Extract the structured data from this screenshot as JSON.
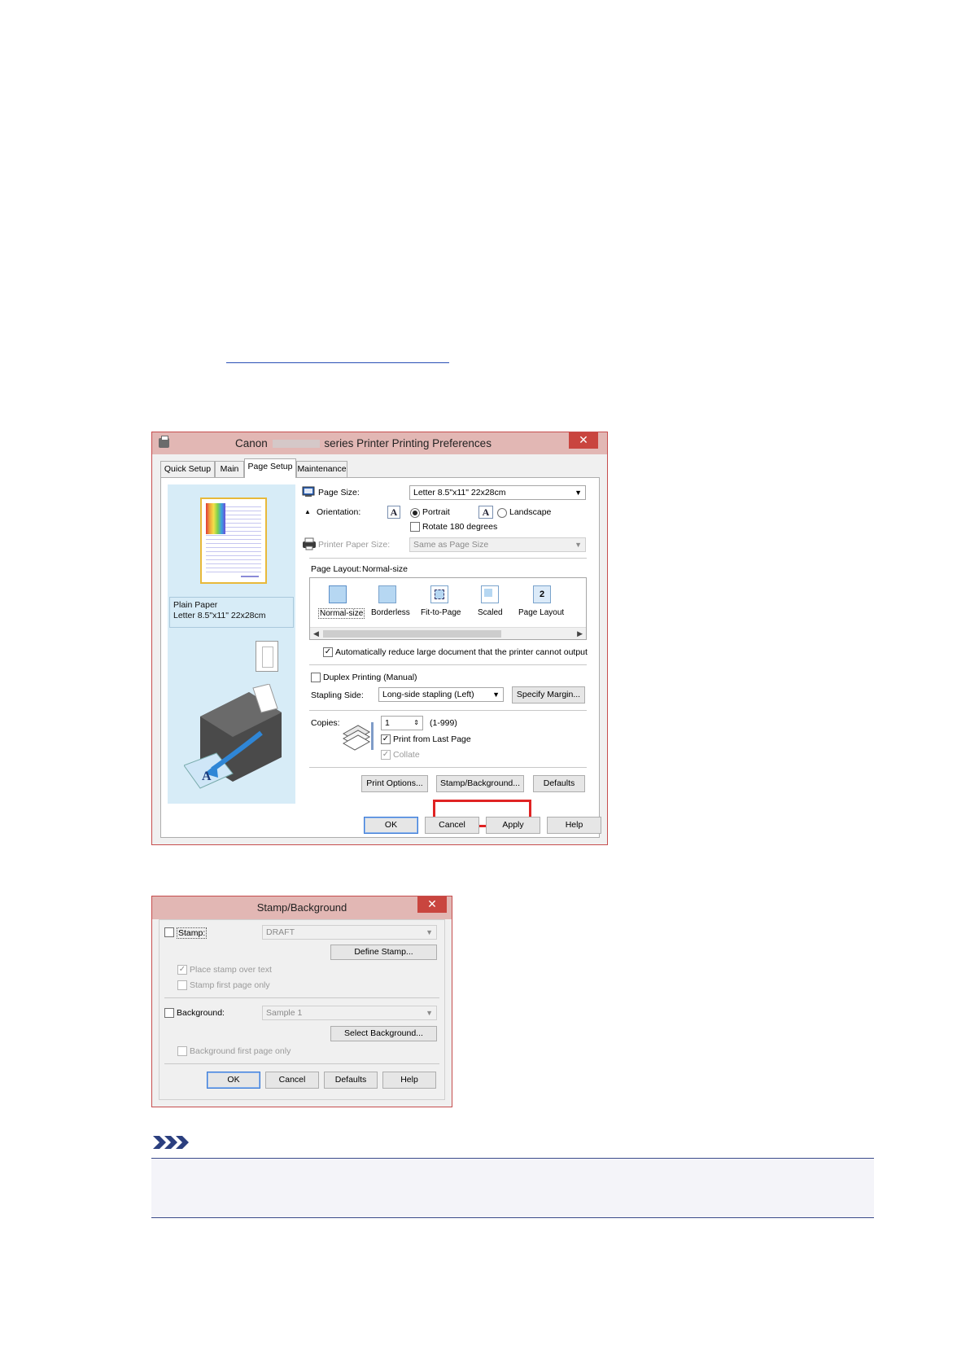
{
  "main_dialog": {
    "title_prefix": "Canon",
    "title_suffix": "series Printer Printing Preferences",
    "close_glyph": "✕",
    "tabs": [
      "Quick Setup",
      "Main",
      "Page Setup",
      "Maintenance"
    ],
    "media_type": "Plain Paper",
    "media_size": "Letter 8.5\"x11\" 22x28cm",
    "page_size_label": "Page Size:",
    "page_size_value": "Letter 8.5\"x11\" 22x28cm",
    "orientation_label": "Orientation:",
    "portrait_label": "Portrait",
    "landscape_label": "Landscape",
    "rotate_label": "Rotate 180 degrees",
    "printer_paper_size_label": "Printer Paper Size:",
    "printer_paper_size_value": "Same as Page Size",
    "page_layout_label": "Page Layout:",
    "page_layout_value": "Normal-size",
    "layouts": [
      "Normal-size",
      "Borderless",
      "Fit-to-Page",
      "Scaled",
      "Page Layout"
    ],
    "auto_reduce_label": "Automatically reduce large document that the printer cannot output",
    "duplex_label": "Duplex Printing (Manual)",
    "stapling_side_label": "Stapling Side:",
    "stapling_side_value": "Long-side stapling (Left)",
    "specify_margin_label": "Specify Margin...",
    "copies_label": "Copies:",
    "copies_value": "1",
    "copies_range": "(1-999)",
    "print_from_last_label": "Print from Last Page",
    "collate_label": "Collate",
    "print_options_label": "Print Options...",
    "stamp_background_label": "Stamp/Background...",
    "defaults_label": "Defaults",
    "ok_label": "OK",
    "cancel_label": "Cancel",
    "apply_label": "Apply",
    "help_label": "Help"
  },
  "stamp_dialog": {
    "title": "Stamp/Background",
    "close_glyph": "✕",
    "stamp_label": "Stamp:",
    "stamp_value": "DRAFT",
    "define_stamp_label": "Define Stamp...",
    "place_over_text_label": "Place stamp over text",
    "stamp_first_page_label": "Stamp first page only",
    "background_label": "Background:",
    "background_value": "Sample 1",
    "select_background_label": "Select Background...",
    "background_first_page_label": "Background first page only",
    "ok_label": "OK",
    "cancel_label": "Cancel",
    "defaults_label": "Defaults",
    "help_label": "Help"
  },
  "colors": {
    "title_bar": "#e2b7b4",
    "close_button": "#c9453f",
    "highlight": "#e02323",
    "preview_bg": "#d7ecf7",
    "note_rule": "#3b4a8a"
  },
  "icons": [
    "printer-icon",
    "note-icon",
    "page-size-icon",
    "printer-paper-size-icon"
  ]
}
